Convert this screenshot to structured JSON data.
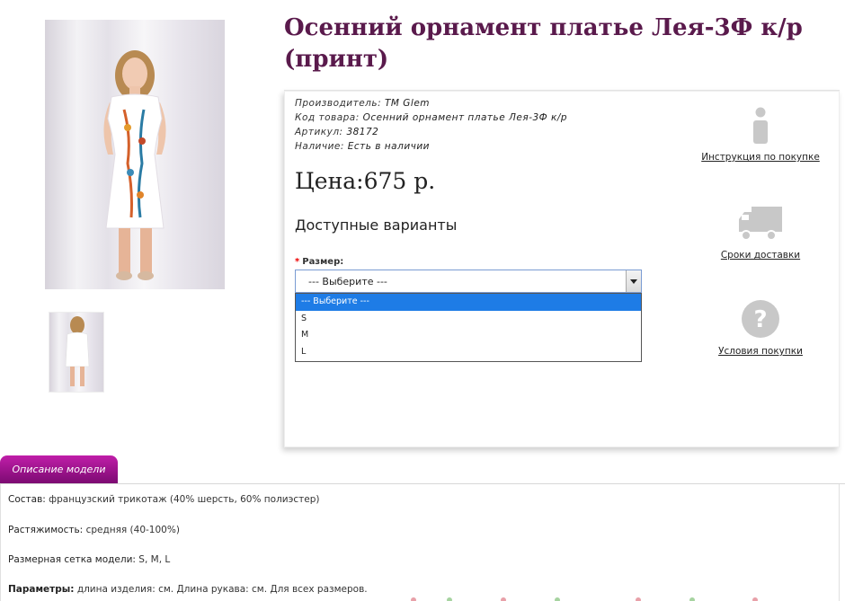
{
  "product": {
    "title": "Осенний орнамент платье Лея-3Ф к/р (принт)"
  },
  "meta": {
    "manufacturer_label": "Производитель:",
    "manufacturer_value": "TM Glem",
    "code_label": "Код товара:",
    "code_value": "Осенний орнамент платье Лея-3Ф к/р",
    "article_label": "Артикул:",
    "article_value": "38172",
    "stock_label": "Наличие:",
    "stock_value": "Есть в наличии"
  },
  "price": "Цена:675 р.",
  "options": {
    "title": "Доступные варианты",
    "size_label": "Размер:",
    "selected": "--- Выберите ---",
    "items": [
      "--- Выберите ---",
      "S",
      "M",
      "L"
    ]
  },
  "side": {
    "instruction": "Инструкция по покупке",
    "delivery": "Сроки доставки",
    "terms": "Условия покупки"
  },
  "tabs": {
    "description": "Описание модели"
  },
  "description": {
    "composition_label": "Состав:",
    "composition_value": "французский трикотаж (40% шерсть, 60% полиэстер)",
    "stretch_label": "Растяжимость:",
    "stretch_value": "средняя (40-100%)",
    "sizes_label": "Размерная сетка модели:",
    "sizes_value": "S, M, L",
    "params_label": "Параметры:",
    "params_value": "длина изделия: см. Длина рукава: см. Для всех размеров."
  },
  "colors": {
    "title": "#5a1a4c",
    "tab": "#a0168f",
    "highlight": "#1e7ce6"
  }
}
